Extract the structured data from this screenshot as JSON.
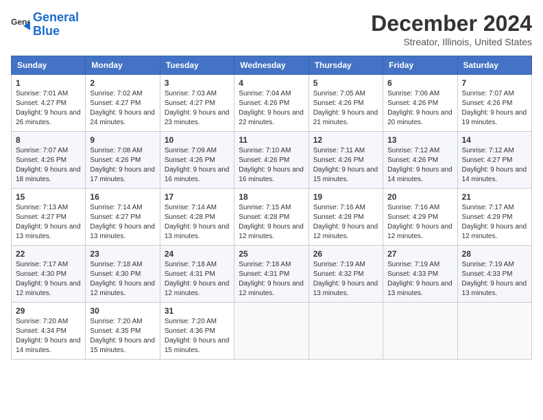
{
  "logo": {
    "text_general": "General",
    "text_blue": "Blue"
  },
  "title": "December 2024",
  "location": "Streator, Illinois, United States",
  "weekdays": [
    "Sunday",
    "Monday",
    "Tuesday",
    "Wednesday",
    "Thursday",
    "Friday",
    "Saturday"
  ],
  "weeks": [
    [
      {
        "day": "1",
        "sunrise": "7:01 AM",
        "sunset": "4:27 PM",
        "daylight": "9 hours and 26 minutes."
      },
      {
        "day": "2",
        "sunrise": "7:02 AM",
        "sunset": "4:27 PM",
        "daylight": "9 hours and 24 minutes."
      },
      {
        "day": "3",
        "sunrise": "7:03 AM",
        "sunset": "4:27 PM",
        "daylight": "9 hours and 23 minutes."
      },
      {
        "day": "4",
        "sunrise": "7:04 AM",
        "sunset": "4:26 PM",
        "daylight": "9 hours and 22 minutes."
      },
      {
        "day": "5",
        "sunrise": "7:05 AM",
        "sunset": "4:26 PM",
        "daylight": "9 hours and 21 minutes."
      },
      {
        "day": "6",
        "sunrise": "7:06 AM",
        "sunset": "4:26 PM",
        "daylight": "9 hours and 20 minutes."
      },
      {
        "day": "7",
        "sunrise": "7:07 AM",
        "sunset": "4:26 PM",
        "daylight": "9 hours and 19 minutes."
      }
    ],
    [
      {
        "day": "8",
        "sunrise": "7:07 AM",
        "sunset": "4:26 PM",
        "daylight": "9 hours and 18 minutes."
      },
      {
        "day": "9",
        "sunrise": "7:08 AM",
        "sunset": "4:26 PM",
        "daylight": "9 hours and 17 minutes."
      },
      {
        "day": "10",
        "sunrise": "7:09 AM",
        "sunset": "4:26 PM",
        "daylight": "9 hours and 16 minutes."
      },
      {
        "day": "11",
        "sunrise": "7:10 AM",
        "sunset": "4:26 PM",
        "daylight": "9 hours and 16 minutes."
      },
      {
        "day": "12",
        "sunrise": "7:11 AM",
        "sunset": "4:26 PM",
        "daylight": "9 hours and 15 minutes."
      },
      {
        "day": "13",
        "sunrise": "7:12 AM",
        "sunset": "4:26 PM",
        "daylight": "9 hours and 14 minutes."
      },
      {
        "day": "14",
        "sunrise": "7:12 AM",
        "sunset": "4:27 PM",
        "daylight": "9 hours and 14 minutes."
      }
    ],
    [
      {
        "day": "15",
        "sunrise": "7:13 AM",
        "sunset": "4:27 PM",
        "daylight": "9 hours and 13 minutes."
      },
      {
        "day": "16",
        "sunrise": "7:14 AM",
        "sunset": "4:27 PM",
        "daylight": "9 hours and 13 minutes."
      },
      {
        "day": "17",
        "sunrise": "7:14 AM",
        "sunset": "4:28 PM",
        "daylight": "9 hours and 13 minutes."
      },
      {
        "day": "18",
        "sunrise": "7:15 AM",
        "sunset": "4:28 PM",
        "daylight": "9 hours and 12 minutes."
      },
      {
        "day": "19",
        "sunrise": "7:16 AM",
        "sunset": "4:28 PM",
        "daylight": "9 hours and 12 minutes."
      },
      {
        "day": "20",
        "sunrise": "7:16 AM",
        "sunset": "4:29 PM",
        "daylight": "9 hours and 12 minutes."
      },
      {
        "day": "21",
        "sunrise": "7:17 AM",
        "sunset": "4:29 PM",
        "daylight": "9 hours and 12 minutes."
      }
    ],
    [
      {
        "day": "22",
        "sunrise": "7:17 AM",
        "sunset": "4:30 PM",
        "daylight": "9 hours and 12 minutes."
      },
      {
        "day": "23",
        "sunrise": "7:18 AM",
        "sunset": "4:30 PM",
        "daylight": "9 hours and 12 minutes."
      },
      {
        "day": "24",
        "sunrise": "7:18 AM",
        "sunset": "4:31 PM",
        "daylight": "9 hours and 12 minutes."
      },
      {
        "day": "25",
        "sunrise": "7:18 AM",
        "sunset": "4:31 PM",
        "daylight": "9 hours and 12 minutes."
      },
      {
        "day": "26",
        "sunrise": "7:19 AM",
        "sunset": "4:32 PM",
        "daylight": "9 hours and 13 minutes."
      },
      {
        "day": "27",
        "sunrise": "7:19 AM",
        "sunset": "4:33 PM",
        "daylight": "9 hours and 13 minutes."
      },
      {
        "day": "28",
        "sunrise": "7:19 AM",
        "sunset": "4:33 PM",
        "daylight": "9 hours and 13 minutes."
      }
    ],
    [
      {
        "day": "29",
        "sunrise": "7:20 AM",
        "sunset": "4:34 PM",
        "daylight": "9 hours and 14 minutes."
      },
      {
        "day": "30",
        "sunrise": "7:20 AM",
        "sunset": "4:35 PM",
        "daylight": "9 hours and 15 minutes."
      },
      {
        "day": "31",
        "sunrise": "7:20 AM",
        "sunset": "4:36 PM",
        "daylight": "9 hours and 15 minutes."
      },
      null,
      null,
      null,
      null
    ]
  ]
}
